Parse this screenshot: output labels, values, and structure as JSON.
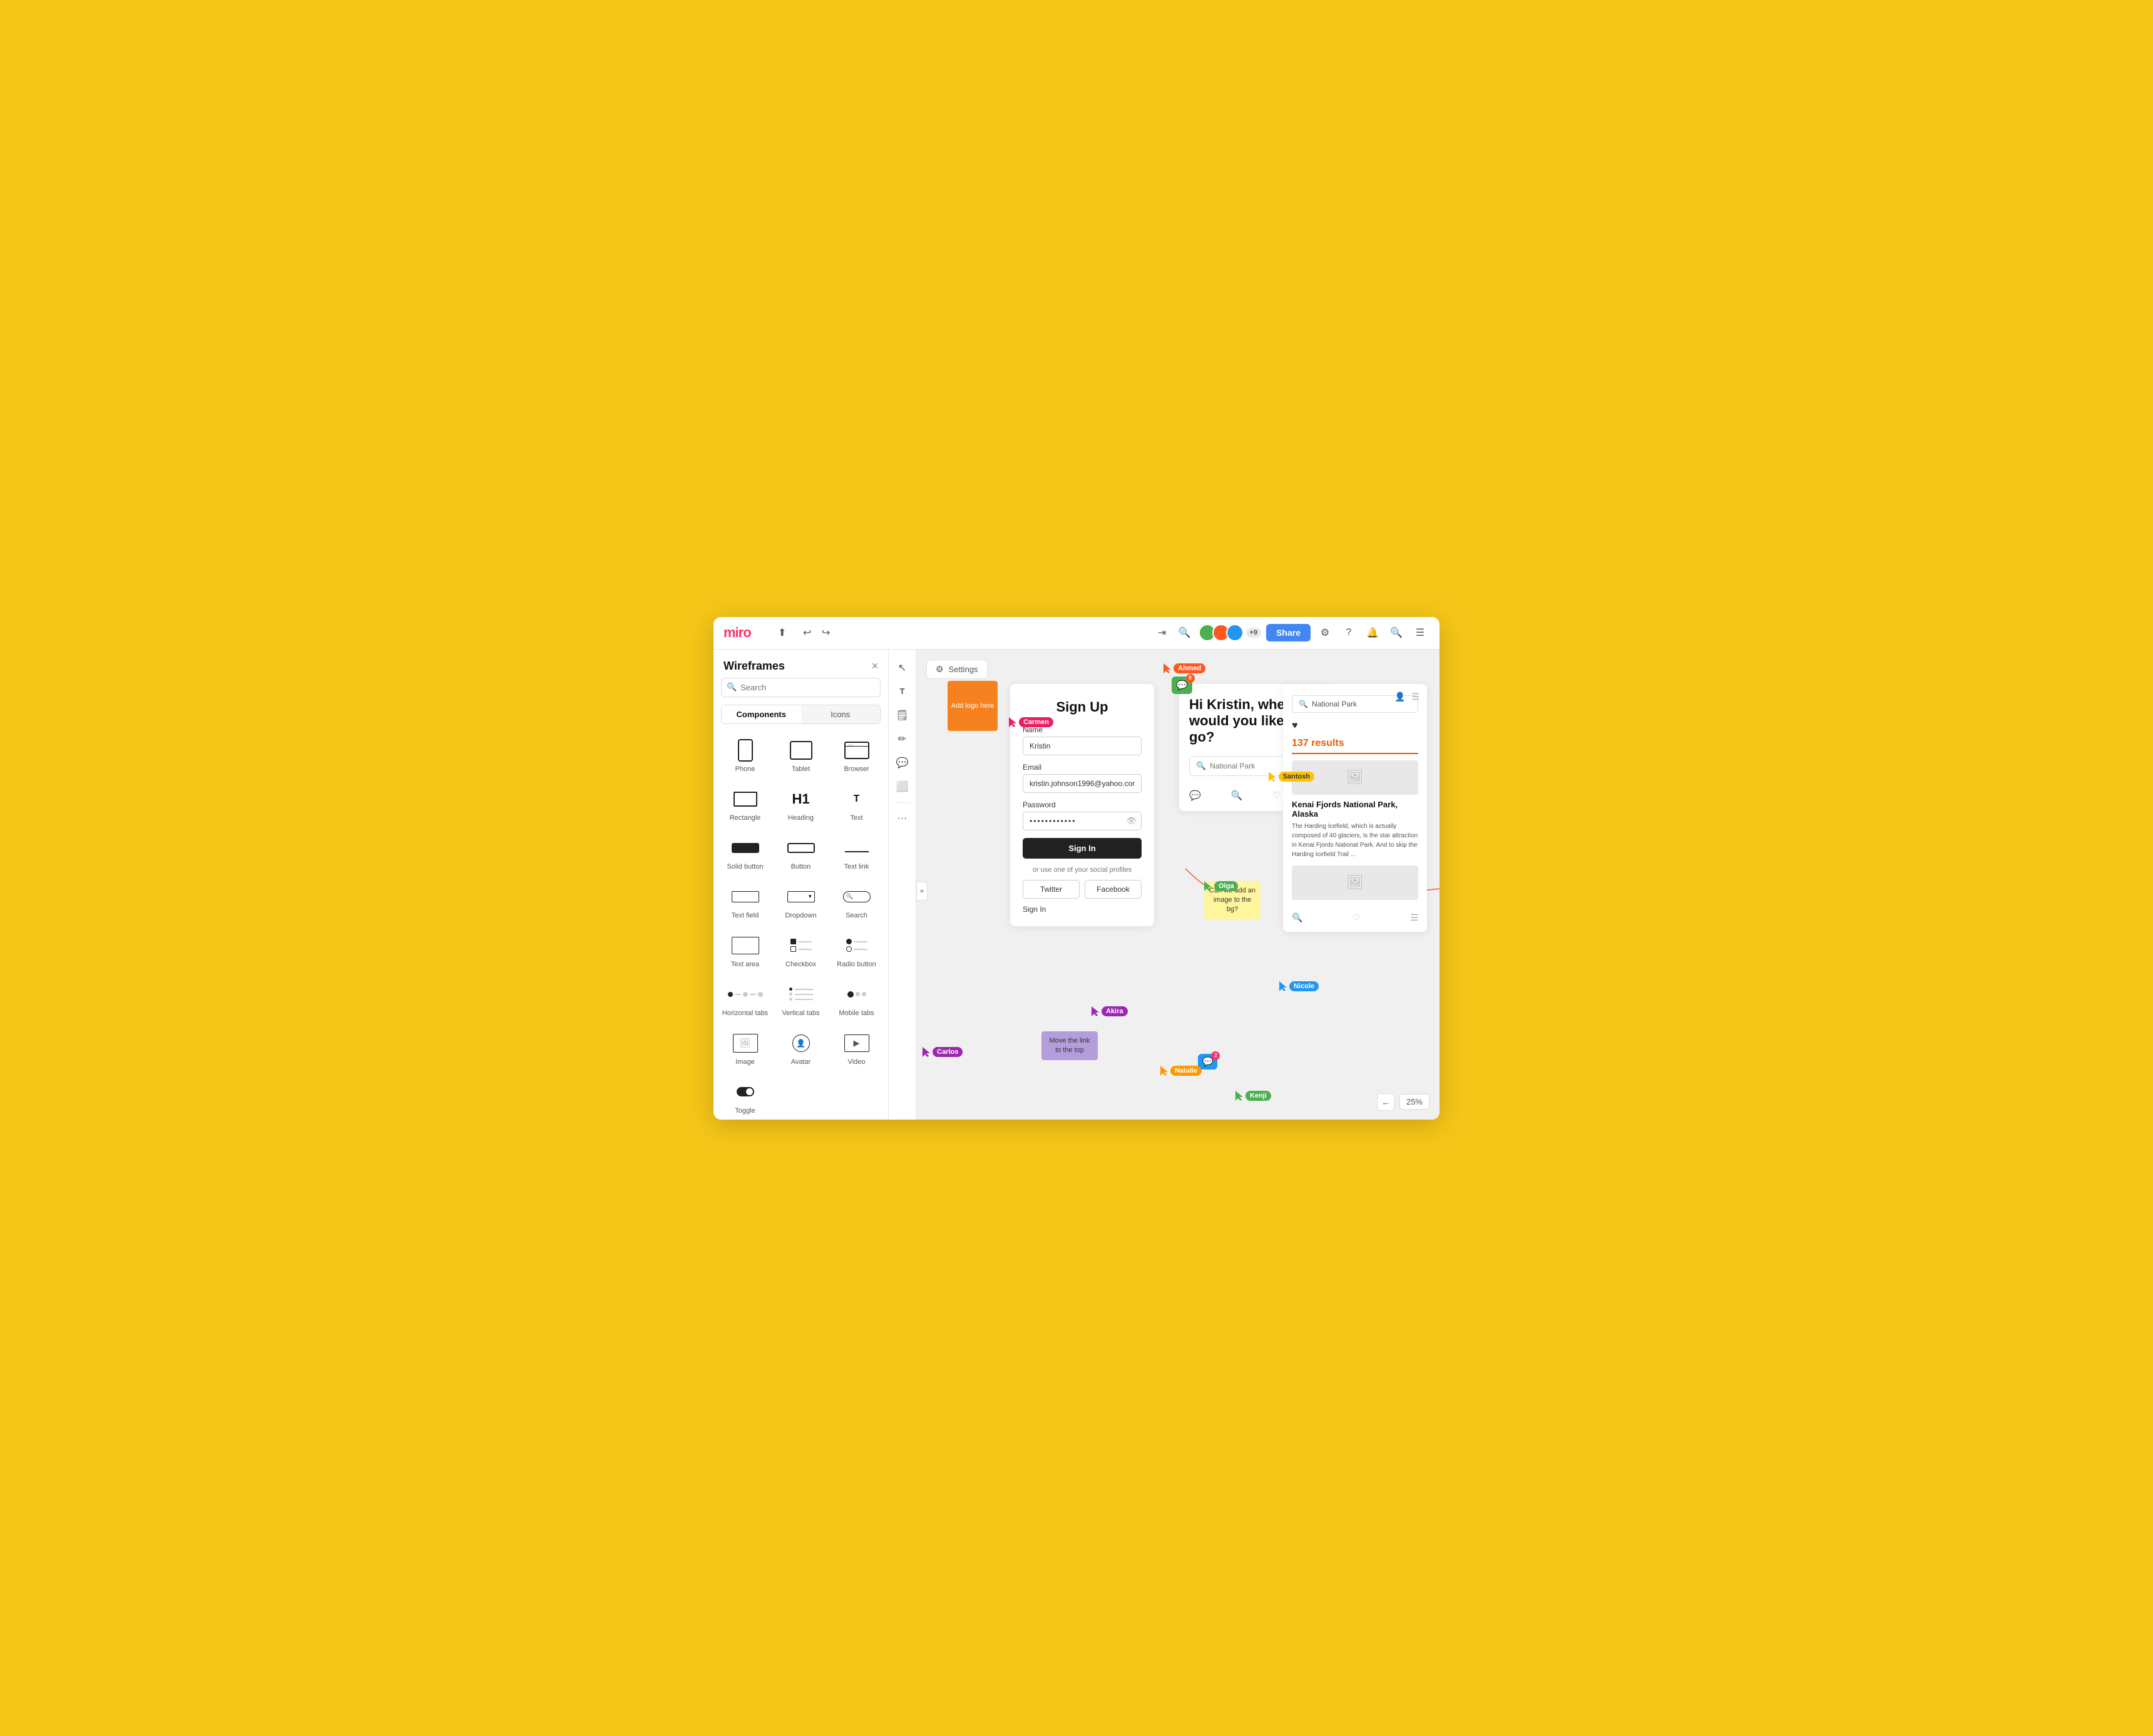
{
  "app": {
    "title": "Wireframes",
    "board_title": "Wireframe",
    "close_label": "×"
  },
  "topbar": {
    "logo": "miro",
    "share_label": "Share",
    "avatar_count": "+9",
    "zoom_level": "25%"
  },
  "sidebar": {
    "title": "Wireframes",
    "search_placeholder": "Search",
    "tabs": [
      "Components",
      "Icons"
    ],
    "components": [
      {
        "label": "Phone",
        "icon": "phone"
      },
      {
        "label": "Tablet",
        "icon": "tablet"
      },
      {
        "label": "Browser",
        "icon": "browser"
      },
      {
        "label": "Rectangle",
        "icon": "rect"
      },
      {
        "label": "Heading",
        "icon": "h1"
      },
      {
        "label": "Text",
        "icon": "text"
      },
      {
        "label": "Solid button",
        "icon": "solid-btn"
      },
      {
        "label": "Button",
        "icon": "btn"
      },
      {
        "label": "Text link",
        "icon": "text-link"
      },
      {
        "label": "Text field",
        "icon": "text-field"
      },
      {
        "label": "Dropdown",
        "icon": "dropdown"
      },
      {
        "label": "Search",
        "icon": "search"
      },
      {
        "label": "Text area",
        "icon": "textarea"
      },
      {
        "label": "Checkbox",
        "icon": "checkbox"
      },
      {
        "label": "Radio button",
        "icon": "radio-btn"
      },
      {
        "label": "Horizontal tabs",
        "icon": "htabs"
      },
      {
        "label": "Vertical tabs",
        "icon": "vtabs"
      },
      {
        "label": "Mobile tabs",
        "icon": "mtabs"
      },
      {
        "label": "Image",
        "icon": "image"
      },
      {
        "label": "Avatar",
        "icon": "avatar"
      },
      {
        "label": "Video",
        "icon": "video"
      },
      {
        "label": "Toggle",
        "icon": "toggle"
      }
    ]
  },
  "signup_form": {
    "title": "Sign Up",
    "name_label": "Name",
    "name_value": "Kristin",
    "email_label": "Email",
    "email_value": "kristin.johnson1996@yahoo.com",
    "password_label": "Password",
    "password_value": "············",
    "signin_btn": "Sign In",
    "social_text": "or use one of your social profiles",
    "twitter_btn": "Twitter",
    "facebook_btn": "Facebook",
    "signin_link": "Sign In"
  },
  "orange_logo": {
    "text": "Add logo here"
  },
  "kristin_frame": {
    "title": "Hi Kristin, where would you like to go?",
    "search_placeholder": "National Park"
  },
  "np_frame": {
    "search_value": "National Park",
    "results_count": "137 results",
    "card_title": "Kenai Fjords National Park, Alaska",
    "card_desc": "The Harding Icefield, which is actually composed of 40 glaciers, is the star attraction in Kenai Fjords National Park. And to skip the Harding Icefield Trail ..."
  },
  "sticky_notes": [
    {
      "text": "Move the link to the top",
      "color": "#b39ddb",
      "id": "purple-note"
    },
    {
      "text": "Can we add an image to the bg?",
      "color": "#fff59d",
      "id": "yellow-note"
    }
  ],
  "cursors": [
    {
      "name": "Ahmed",
      "color": "#FF5722"
    },
    {
      "name": "Carmen",
      "color": "#E91E63"
    },
    {
      "name": "Olga",
      "color": "#4CAF50"
    },
    {
      "name": "Akira",
      "color": "#9C27B0"
    },
    {
      "name": "Natalie",
      "color": "#FF9800"
    },
    {
      "name": "Kenji",
      "color": "#4CAF50"
    },
    {
      "name": "Nicole",
      "color": "#2196F3"
    },
    {
      "name": "Santosh",
      "color": "#FFC107"
    },
    {
      "name": "Carlos",
      "color": "#9C27B0"
    }
  ],
  "settings_label": "Settings",
  "collapse_btn": "»"
}
